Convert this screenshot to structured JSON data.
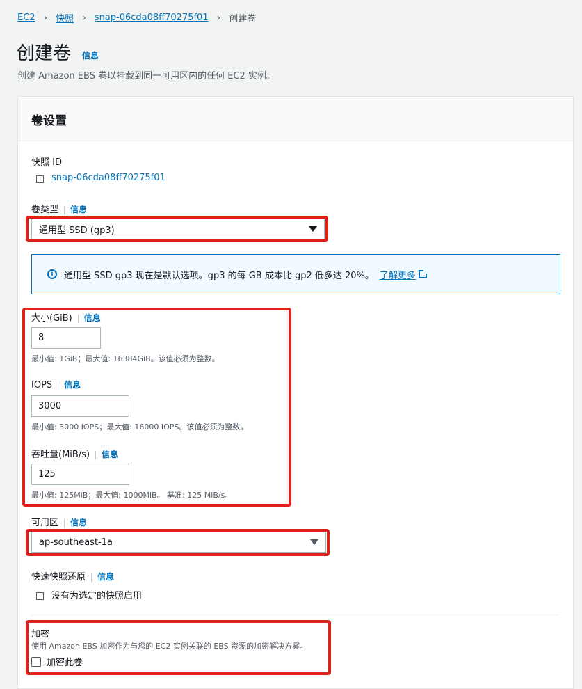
{
  "breadcrumb": {
    "items": [
      "EC2",
      "快照",
      "snap-06cda08ff70275f01",
      "创建卷"
    ]
  },
  "header": {
    "title": "创建卷",
    "info": "信息",
    "description": "创建 Amazon EBS 卷以挂载到同一可用区内的任何 EC2 实例。"
  },
  "panel": {
    "title": "卷设置",
    "snapshot": {
      "label": "快照 ID",
      "value": "snap-06cda08ff70275f01"
    },
    "volume_type": {
      "label": "卷类型",
      "info": "信息",
      "selected": "通用型 SSD (gp3)"
    },
    "callout": {
      "text": "通用型 SSD gp3 现在是默认选项。gp3 的每 GB 成本比 gp2 低多达 20%。",
      "link": "了解更多"
    },
    "size": {
      "label": "大小(GiB)",
      "info": "信息",
      "value": "8",
      "hint": "最小值: 1GiB；最大值: 16384GiB。该值必须为整数。"
    },
    "iops": {
      "label": "IOPS",
      "info": "信息",
      "value": "3000",
      "hint": "最小值: 3000 IOPS；最大值: 16000 IOPS。该值必须为整数。"
    },
    "throughput": {
      "label": "吞吐量(MiB/s)",
      "info": "信息",
      "value": "125",
      "hint": "最小值: 125MiB；最大值: 1000MiB。 基准: 125 MiB/s。"
    },
    "az": {
      "label": "可用区",
      "info": "信息",
      "selected": "ap-southeast-1a"
    },
    "fast_restore": {
      "label": "快速快照还原",
      "info": "信息",
      "value": "没有为选定的快照启用"
    },
    "encryption": {
      "label": "加密",
      "description": "使用 Amazon EBS 加密作为与您的 EC2 实例关联的 EBS 资源的加密解决方案。",
      "checkbox_label": "加密此卷"
    }
  },
  "colors": {
    "link": "#0073bb",
    "highlight": "#e0201b",
    "callout_bg": "#f1faff"
  }
}
